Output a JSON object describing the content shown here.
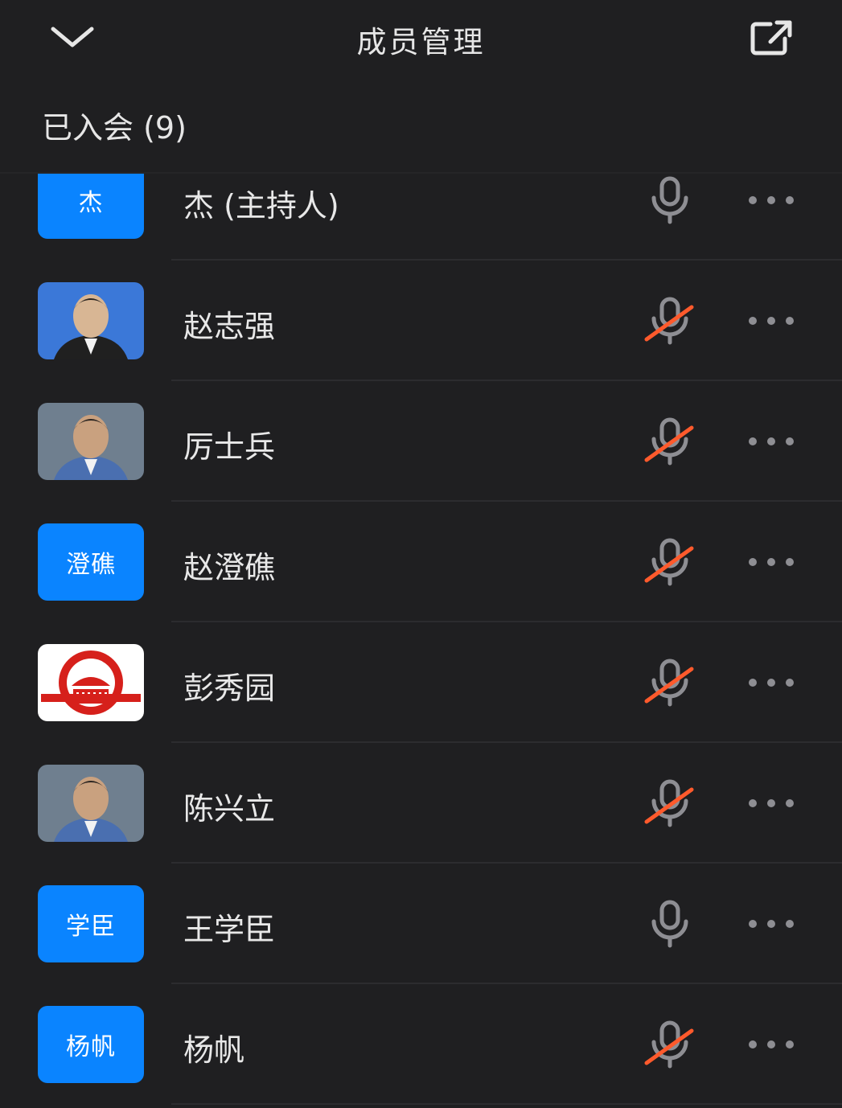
{
  "header": {
    "title": "成员管理",
    "back_icon": "chevron-down-icon",
    "popout_icon": "external-link-icon"
  },
  "section": {
    "title": "已入会 (9)"
  },
  "members": [
    {
      "name": "杰 (主持人)",
      "avatar_text": "杰",
      "avatar_type": "text",
      "mic": "on"
    },
    {
      "name": "赵志强",
      "avatar_text": "",
      "avatar_type": "photo",
      "mic": "muted"
    },
    {
      "name": "厉士兵",
      "avatar_text": "",
      "avatar_type": "photo",
      "mic": "muted"
    },
    {
      "name": "赵澄礁",
      "avatar_text": "澄礁",
      "avatar_type": "text",
      "mic": "muted"
    },
    {
      "name": "彭秀园",
      "avatar_text": "",
      "avatar_type": "logo",
      "mic": "muted"
    },
    {
      "name": "陈兴立",
      "avatar_text": "",
      "avatar_type": "photo",
      "mic": "muted"
    },
    {
      "name": "王学臣",
      "avatar_text": "学臣",
      "avatar_type": "text",
      "mic": "on"
    },
    {
      "name": "杨帆",
      "avatar_text": "杨帆",
      "avatar_type": "text",
      "mic": "muted"
    }
  ],
  "colors": {
    "background": "#1f1f21",
    "avatar_blue": "#0a84ff",
    "mute_slash": "#ff5a2c",
    "icon_gray": "#8e8e93"
  }
}
